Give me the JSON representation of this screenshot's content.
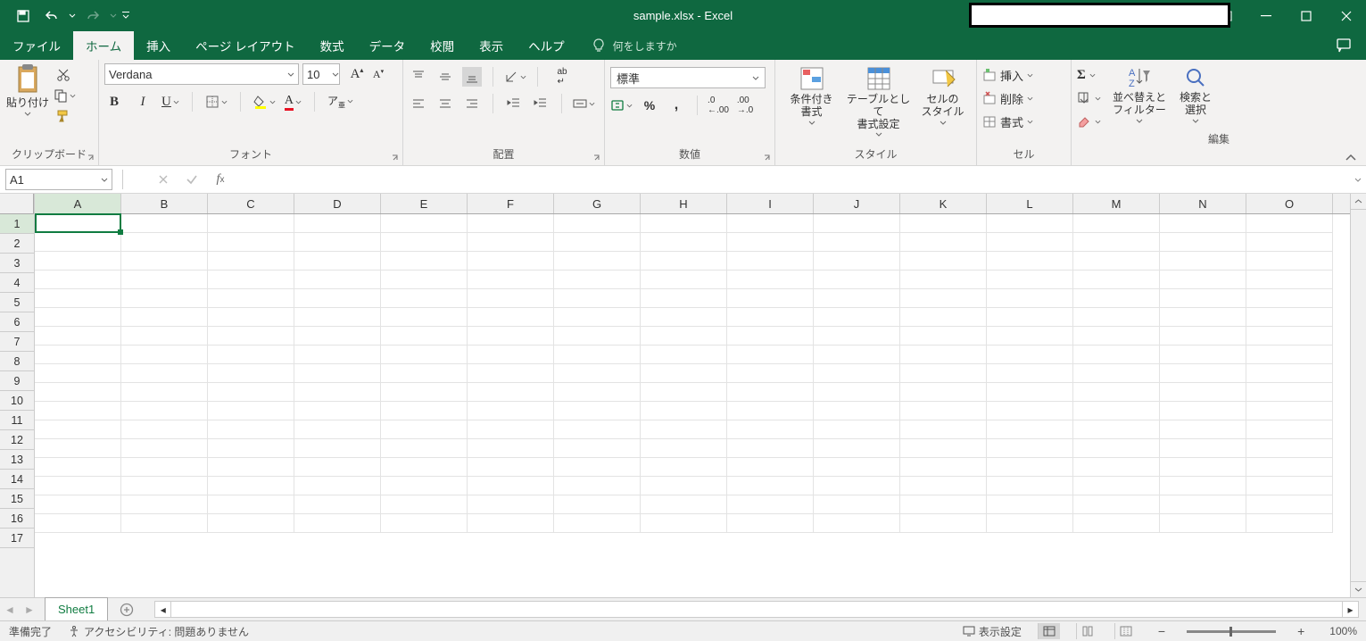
{
  "title": "sample.xlsx  -  Excel",
  "tabs": {
    "file": "ファイル",
    "home": "ホーム",
    "insert": "挿入",
    "pagelayout": "ページ レイアウト",
    "formulas": "数式",
    "data": "データ",
    "review": "校閲",
    "view": "表示",
    "help": "ヘルプ",
    "tellme": "何をしますか"
  },
  "ribbon": {
    "clipboard": {
      "paste": "貼り付け",
      "label": "クリップボード"
    },
    "font": {
      "name": "Verdana",
      "size": "10",
      "label": "フォント"
    },
    "alignment": {
      "label": "配置"
    },
    "number": {
      "format": "標準",
      "label": "数値"
    },
    "styles": {
      "cond": "条件付き\n書式",
      "table": "テーブルとして\n書式設定",
      "cell": "セルの\nスタイル",
      "label": "スタイル"
    },
    "cells": {
      "insert": "挿入",
      "delete": "削除",
      "format": "書式",
      "label": "セル"
    },
    "editing": {
      "sort": "並べ替えと\nフィルター",
      "find": "検索と\n選択",
      "label": "編集"
    }
  },
  "namebox": "A1",
  "sheet_tab": "Sheet1",
  "status": {
    "ready": "準備完了",
    "a11y": "アクセシビリティ: 問題ありません",
    "display": "表示設定",
    "zoom": "100%"
  },
  "columns": [
    "A",
    "B",
    "C",
    "D",
    "E",
    "F",
    "G",
    "H",
    "I",
    "J",
    "K",
    "L",
    "M",
    "N",
    "O"
  ],
  "rows": [
    "1",
    "2",
    "3",
    "4",
    "5",
    "6",
    "7",
    "8",
    "9",
    "10",
    "11",
    "12",
    "13",
    "14",
    "15",
    "16",
    "17"
  ]
}
